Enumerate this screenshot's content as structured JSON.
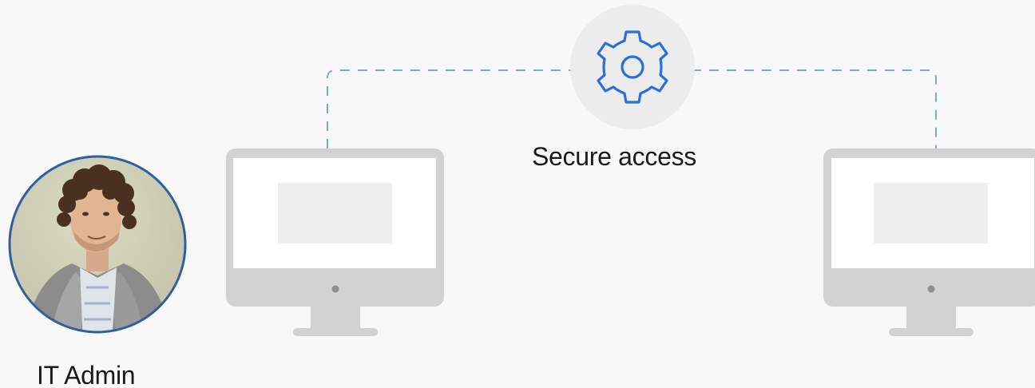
{
  "connection": {
    "label": "Secure access",
    "icon": "gear-icon",
    "line_color": "#7ea7d8"
  },
  "admin": {
    "label": "IT Admin",
    "avatar_border_color": "#2f5f9c"
  },
  "computers": [
    {
      "name": "computer-left",
      "icon": "monitor-icon"
    },
    {
      "name": "computer-right",
      "icon": "monitor-icon"
    }
  ]
}
